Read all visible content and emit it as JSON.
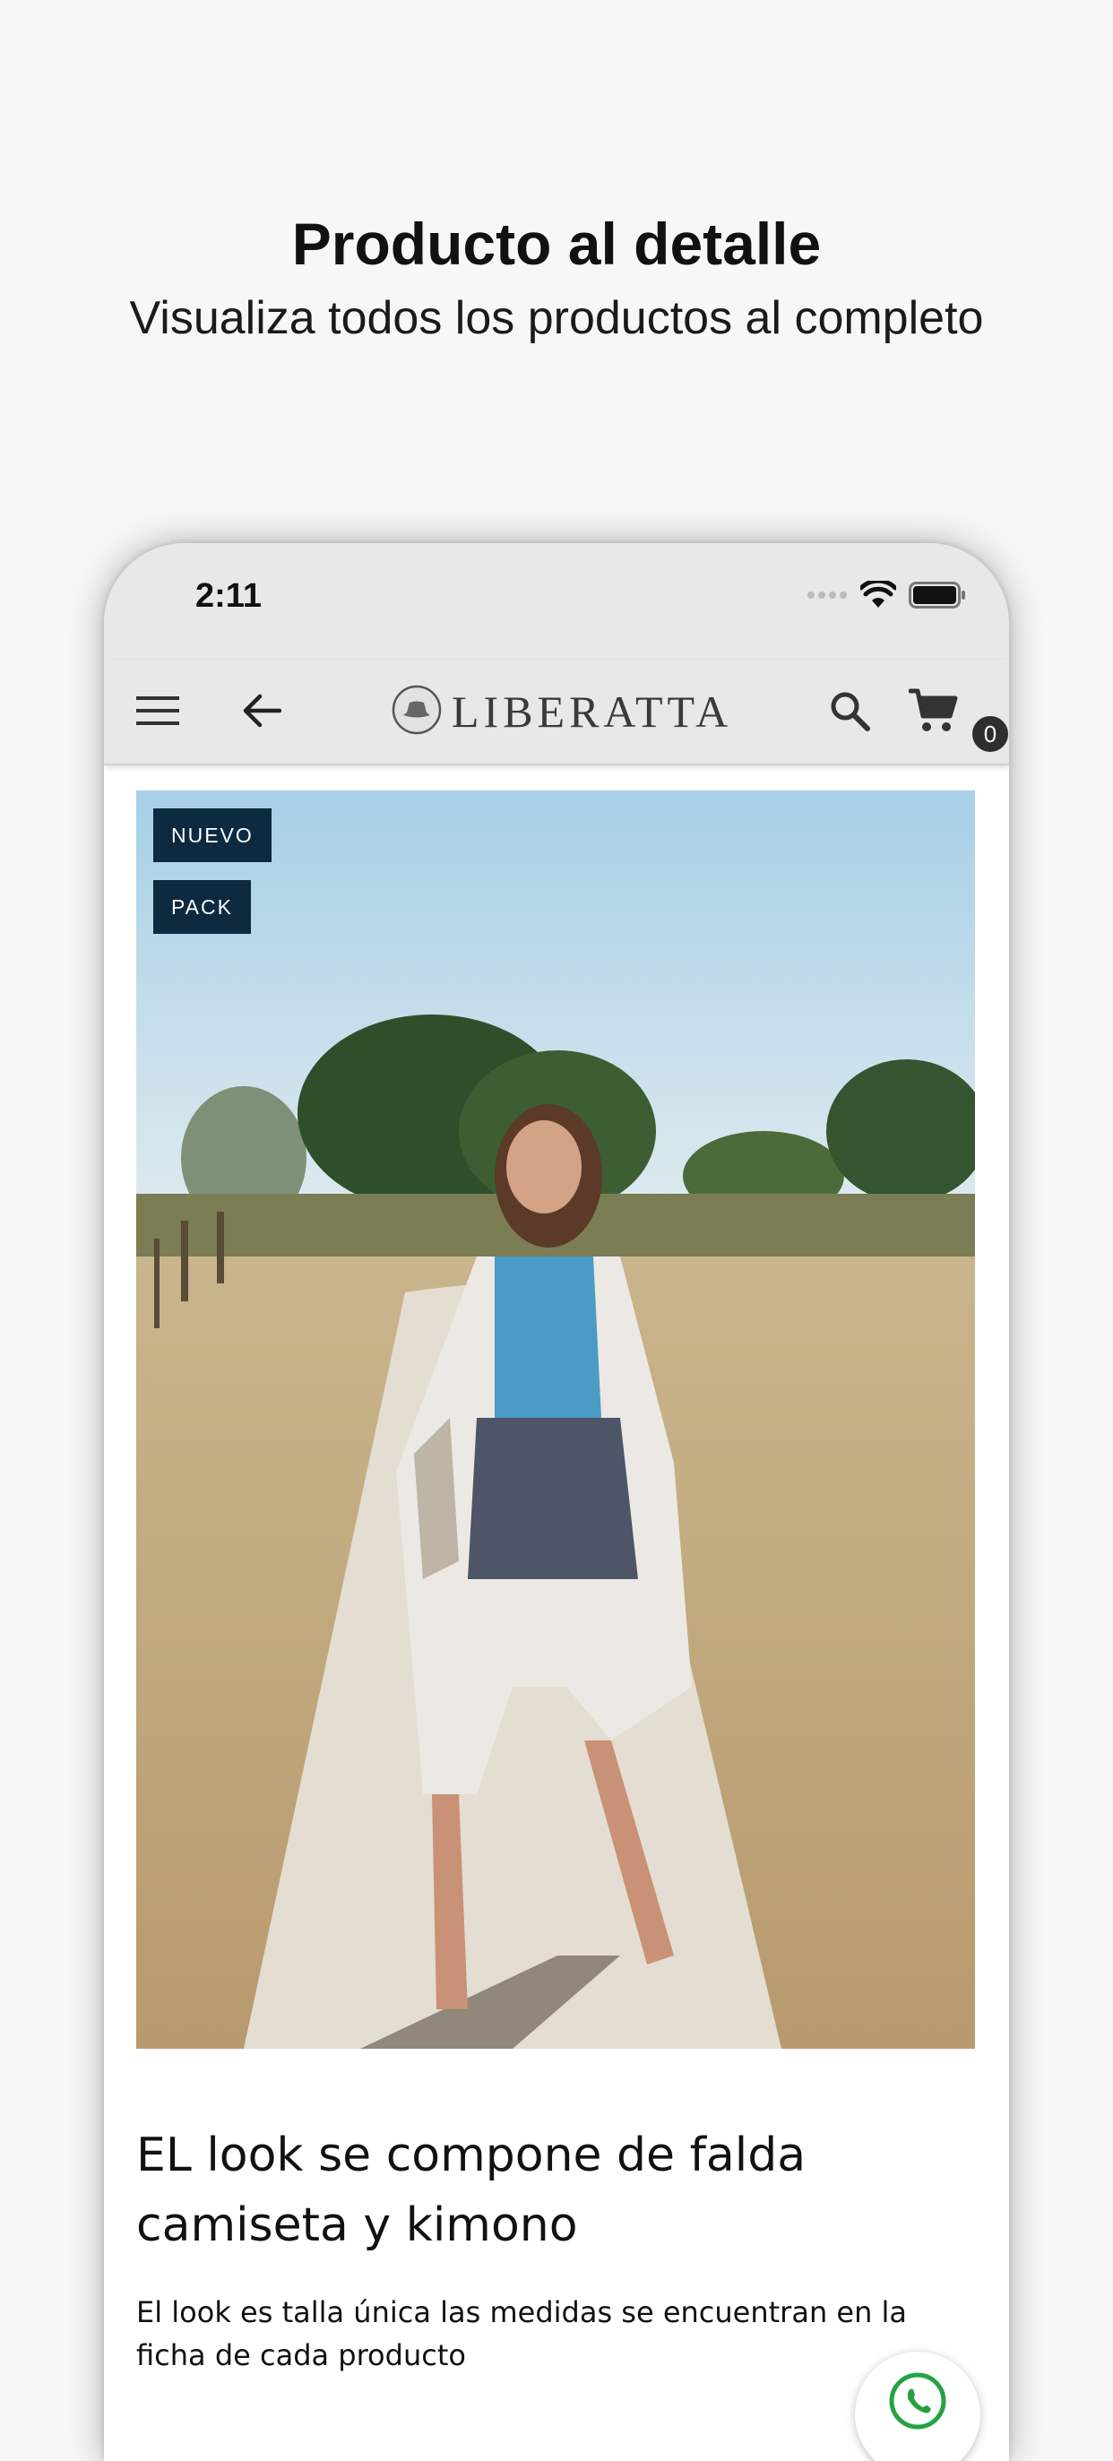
{
  "promo": {
    "title": "Producto al detalle",
    "subtitle": "Visualiza todos los productos al completo"
  },
  "status_bar": {
    "time": "2:11",
    "icons": [
      "signal-dots-icon",
      "wifi-icon",
      "battery-icon"
    ]
  },
  "app_bar": {
    "brand": "LIBERATTA",
    "icons": [
      "menu-icon",
      "back-arrow-icon",
      "search-icon",
      "cart-icon"
    ],
    "cart_count": "0"
  },
  "product": {
    "badges": [
      "NUEVO",
      "PACK"
    ],
    "title": "EL look se compone de falda camiseta y kimono",
    "description": "El look es talla única las medidas se encuentran en la ficha de cada producto"
  },
  "colors": {
    "badge_bg": "#0d2a40",
    "app_bar_bg": "#e8e8e8",
    "whatsapp_green": "#25a244"
  }
}
